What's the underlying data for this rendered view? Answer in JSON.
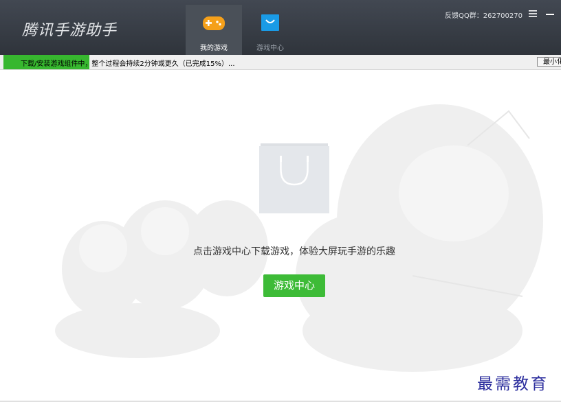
{
  "app": {
    "title": "腾讯手游助手"
  },
  "nav": {
    "tabs": [
      {
        "label": "我的游戏",
        "icon": "gamepad-icon",
        "active": true
      },
      {
        "label": "游戏中心",
        "icon": "shopping-bag-icon",
        "active": false
      }
    ]
  },
  "header": {
    "feedback": "反馈QQ群：262700270",
    "menu_icon": "hamburger-menu-icon",
    "minimize_icon": "minimize-icon"
  },
  "progress": {
    "text": "下载/安装游戏组件中，整个过程会持续2分钟或更久（已完成15%）...",
    "percent": 15,
    "minimize_label": "最小化"
  },
  "main": {
    "empty_message": "点击游戏中心下载游戏，体验大屏玩手游的乐趣",
    "button_label": "游戏中心",
    "watermark": "最需教育"
  },
  "colors": {
    "titlebar": "#393e45",
    "active_tab": "#4a5058",
    "accent_green": "#3dbb37",
    "gamepad_orange": "#f5a01a",
    "bag_blue": "#1a9be6",
    "watermark": "#2d2f9e"
  }
}
